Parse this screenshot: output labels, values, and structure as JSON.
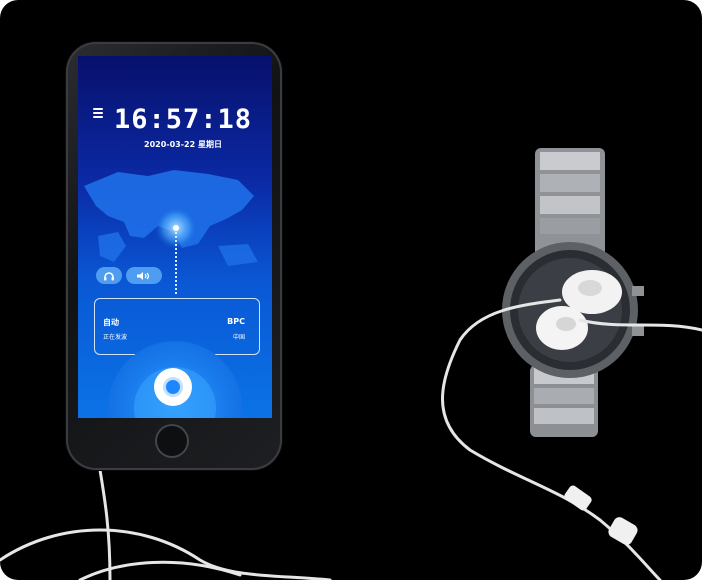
{
  "phone_app": {
    "clock": {
      "time": "16:57:18",
      "date": "2020-03-22  星期日"
    },
    "signal_card": {
      "mode": "自动",
      "status": "正在发波",
      "station": "BPC",
      "country": "中国"
    },
    "icons": [
      "menu-icon",
      "headphones-icon",
      "speaker-icon",
      "play-icon"
    ]
  },
  "colors": {
    "screen_top": "#07106b",
    "screen_bottom": "#0b73e6",
    "accent": "#1e86ff",
    "background": "#000000"
  }
}
